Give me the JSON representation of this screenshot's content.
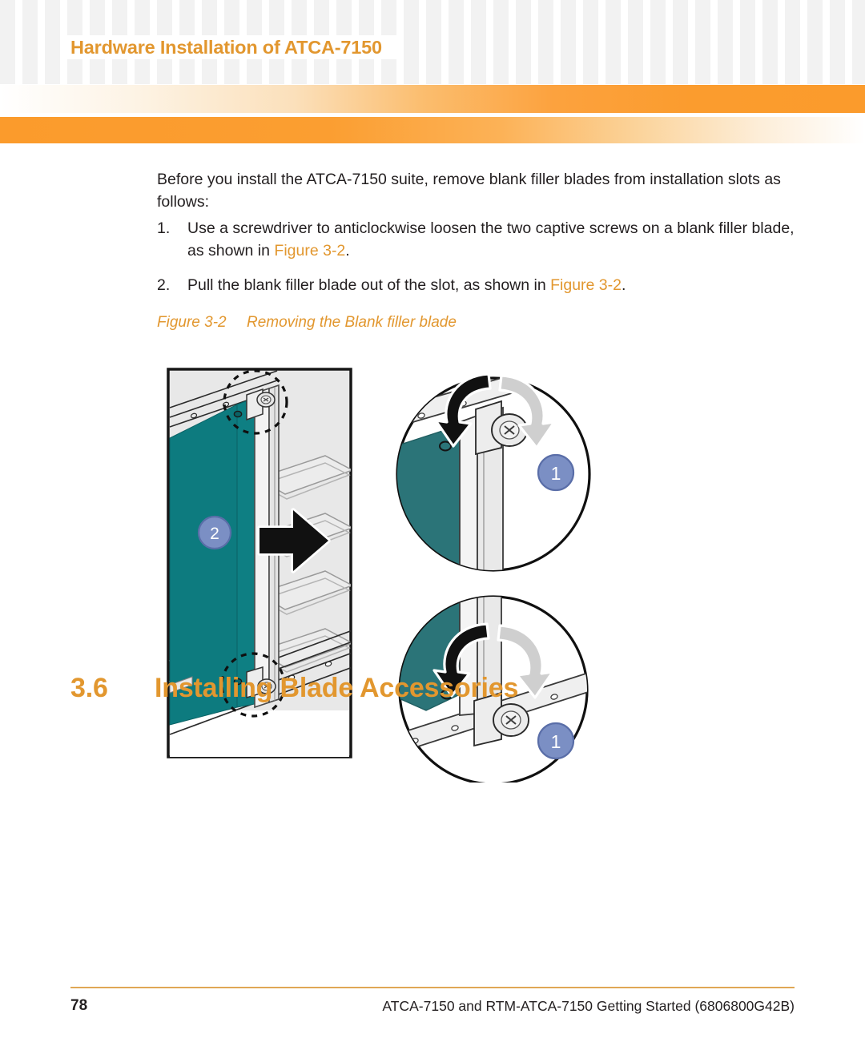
{
  "header": {
    "title": "Hardware Installation of ATCA-7150"
  },
  "body": {
    "intro": "Before you install the ATCA-7150 suite, remove blank filler blades from installation slots as follows:",
    "steps": [
      {
        "number": "1.",
        "text_before": "Use a screwdriver to anticlockwise loosen the two captive screws on a blank filler blade, as shown in ",
        "xref": "Figure 3-2",
        "text_after": "."
      },
      {
        "number": "2.",
        "text_before": "Pull the blank filler blade out of the slot, as shown in ",
        "xref": "Figure 3-2",
        "text_after": "."
      }
    ]
  },
  "figure": {
    "label": "Figure 3-2",
    "title": "Removing the Blank filler blade",
    "callouts": [
      {
        "id": "callout-2-main",
        "value": "2"
      },
      {
        "id": "callout-1-upper",
        "value": "1"
      },
      {
        "id": "callout-1-lower",
        "value": "1"
      }
    ],
    "colors": {
      "blade": "#0d7b7f",
      "blade_shade": "#27676b",
      "chassis": "#e8e8e8",
      "callout_fill": "#7b8fc4",
      "callout_stroke": "#5a6ea8",
      "outline": "#1a1a1a"
    }
  },
  "section": {
    "number": "3.6",
    "title": "Installing Blade Accessories"
  },
  "footer": {
    "page_number": "78",
    "document": "ATCA-7150 and RTM-ATCA-7150 Getting Started (6806800G42B)"
  },
  "theme": {
    "accent": "#e2972f",
    "bar_orange": "#fb9b2c",
    "rule": "#e0a755",
    "text": "#231f20"
  }
}
